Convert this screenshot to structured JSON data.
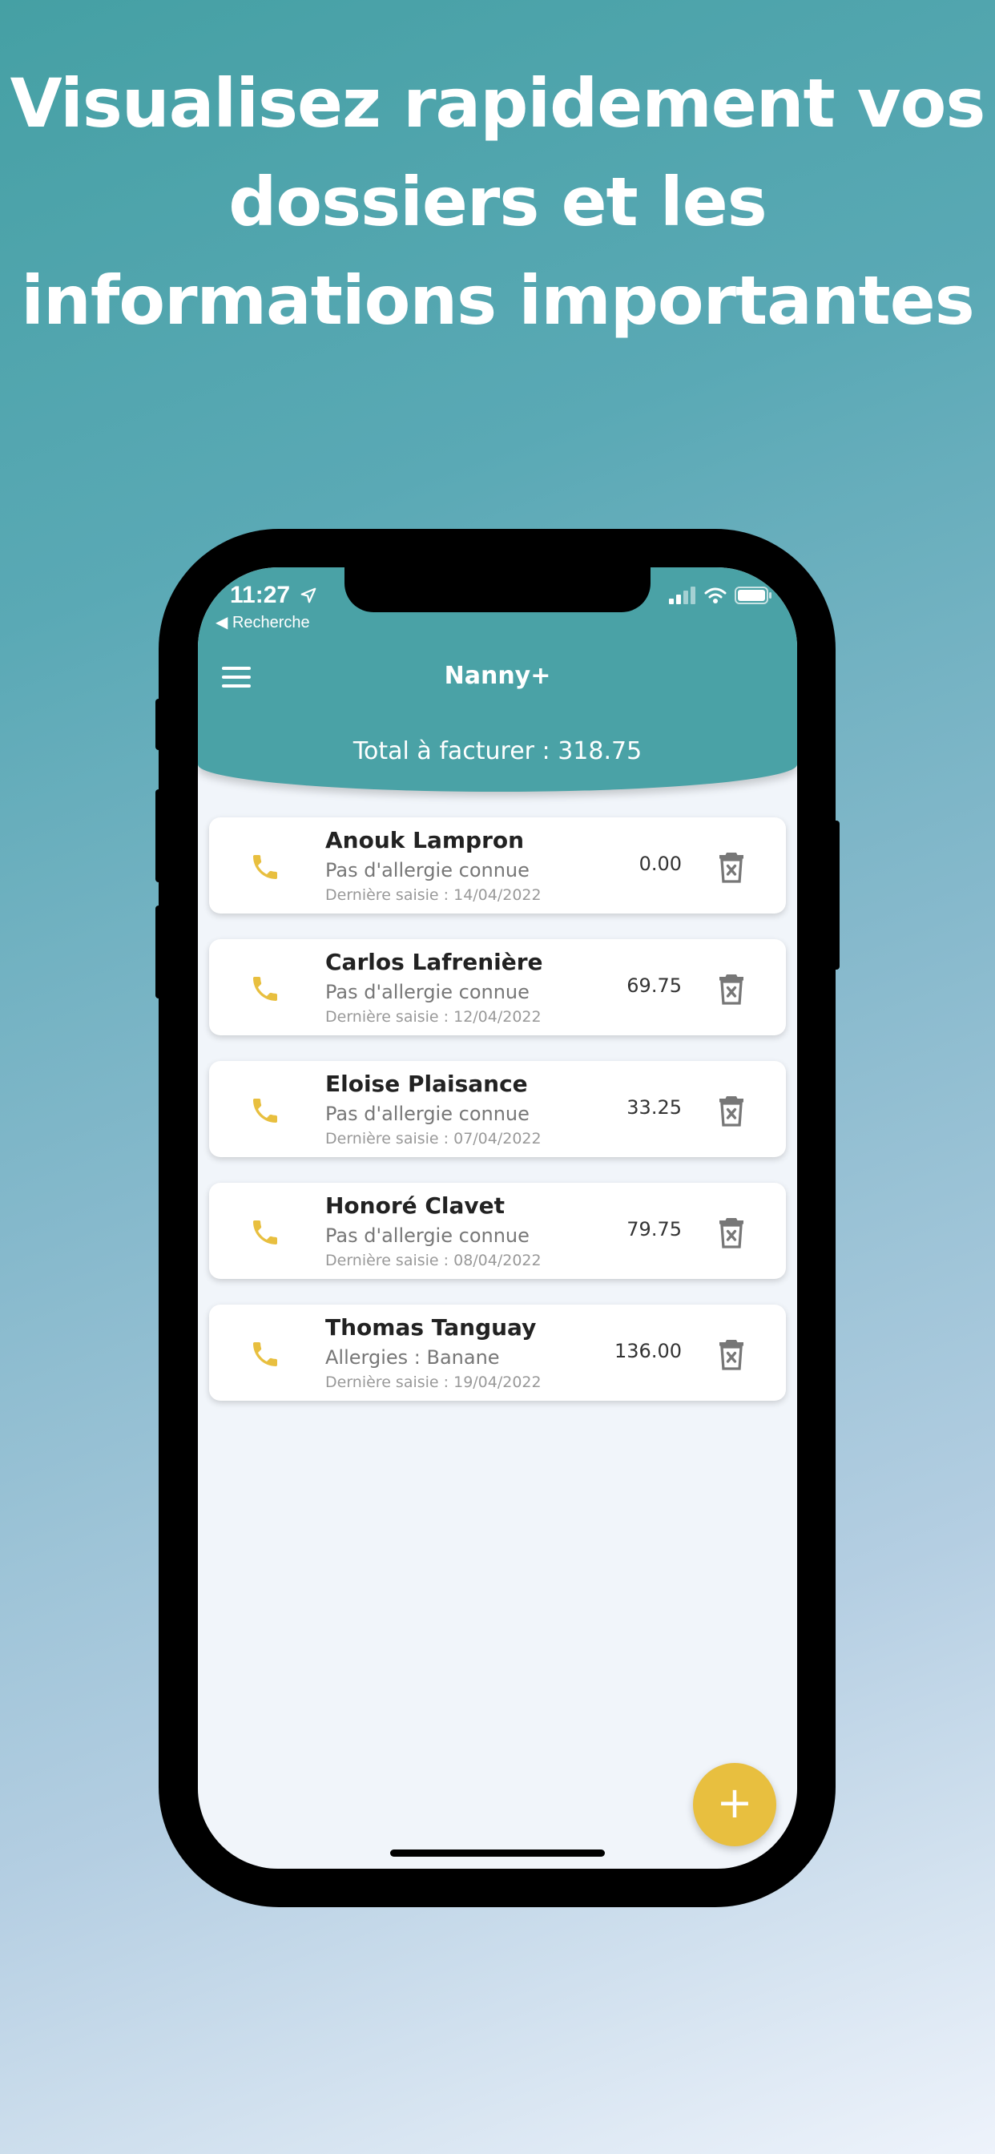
{
  "headline": {
    "line1": "Visualisez rapidement vos",
    "line2": "dossiers et les",
    "line3": "informations importantes"
  },
  "status_bar": {
    "time": "11:27",
    "back_label": "◀ Recherche"
  },
  "app": {
    "title": "Nanny+",
    "total_label": "Total à facturer : 318.75"
  },
  "records": [
    {
      "name": "Anouk Lampron",
      "note": "Pas d'allergie connue",
      "last_entry": "Dernière saisie : 14/04/2022",
      "amount": "0.00"
    },
    {
      "name": "Carlos Lafrenière",
      "note": "Pas d'allergie connue",
      "last_entry": "Dernière saisie : 12/04/2022",
      "amount": "69.75"
    },
    {
      "name": "Eloise Plaisance",
      "note": "Pas d'allergie connue",
      "last_entry": "Dernière saisie : 07/04/2022",
      "amount": "33.25"
    },
    {
      "name": "Honoré Clavet",
      "note": "Pas d'allergie connue",
      "last_entry": "Dernière saisie : 08/04/2022",
      "amount": "79.75"
    },
    {
      "name": "Thomas Tanguay",
      "note": "Allergies : Banane",
      "last_entry": "Dernière saisie : 19/04/2022",
      "amount": "136.00"
    }
  ],
  "fab": {
    "label": "+"
  },
  "icons": {
    "phone": "phone-icon",
    "trash": "trash-icon",
    "menu": "hamburger-menu-icon",
    "location": "location-arrow-icon",
    "signal": "cellular-signal-icon",
    "wifi": "wifi-icon",
    "battery": "battery-icon"
  },
  "colors": {
    "header": "#4aa2a6",
    "accent": "#e8bf3f",
    "list_background": "#f1f5fa"
  }
}
